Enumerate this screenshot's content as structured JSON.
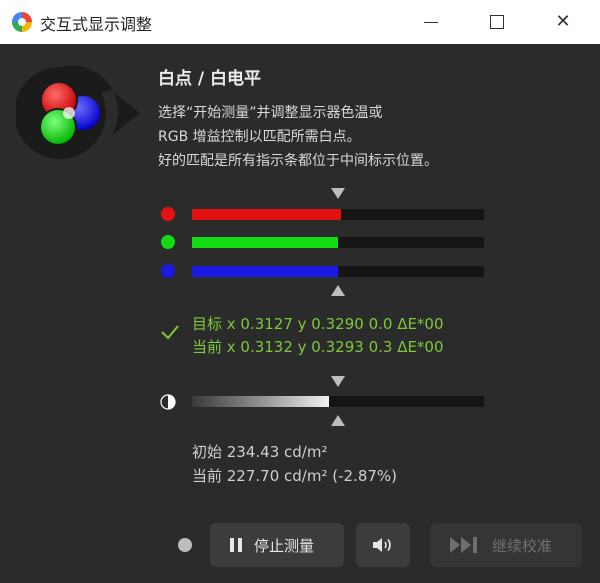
{
  "window": {
    "title": "交互式显示调整",
    "app_icon": "color-wheel-icon"
  },
  "section": {
    "heading": "白点 / 白电平",
    "description_lines": [
      "选择“开始测量”并调整显示器色温或",
      "RGB 增益控制以匹配所需白点。",
      "好的匹配是所有指示条都位于中间标示位置。"
    ]
  },
  "rgb_bars": [
    {
      "channel": "red",
      "color": "#e31212",
      "level": 0.51
    },
    {
      "channel": "green",
      "color": "#14dc14",
      "level": 0.5
    },
    {
      "channel": "blue",
      "color": "#1a1ae0",
      "level": 0.5
    }
  ],
  "target_line": "目标 x 0.3127 y 0.3290 0.0 ΔE*00",
  "current_line": "当前 x 0.3132 y 0.3293 0.3 ΔE*00",
  "luminance_level": 0.47,
  "initial_luminance": "初始 234.43 cd/m²",
  "current_luminance": "当前 227.70 cd/m² (-2.87%)",
  "buttons": {
    "stop": "停止测量",
    "volume_icon": "speaker-icon",
    "next": "继续校准"
  },
  "colors": {
    "accent_green": "#7ec83a",
    "background": "#2b2b2b"
  }
}
